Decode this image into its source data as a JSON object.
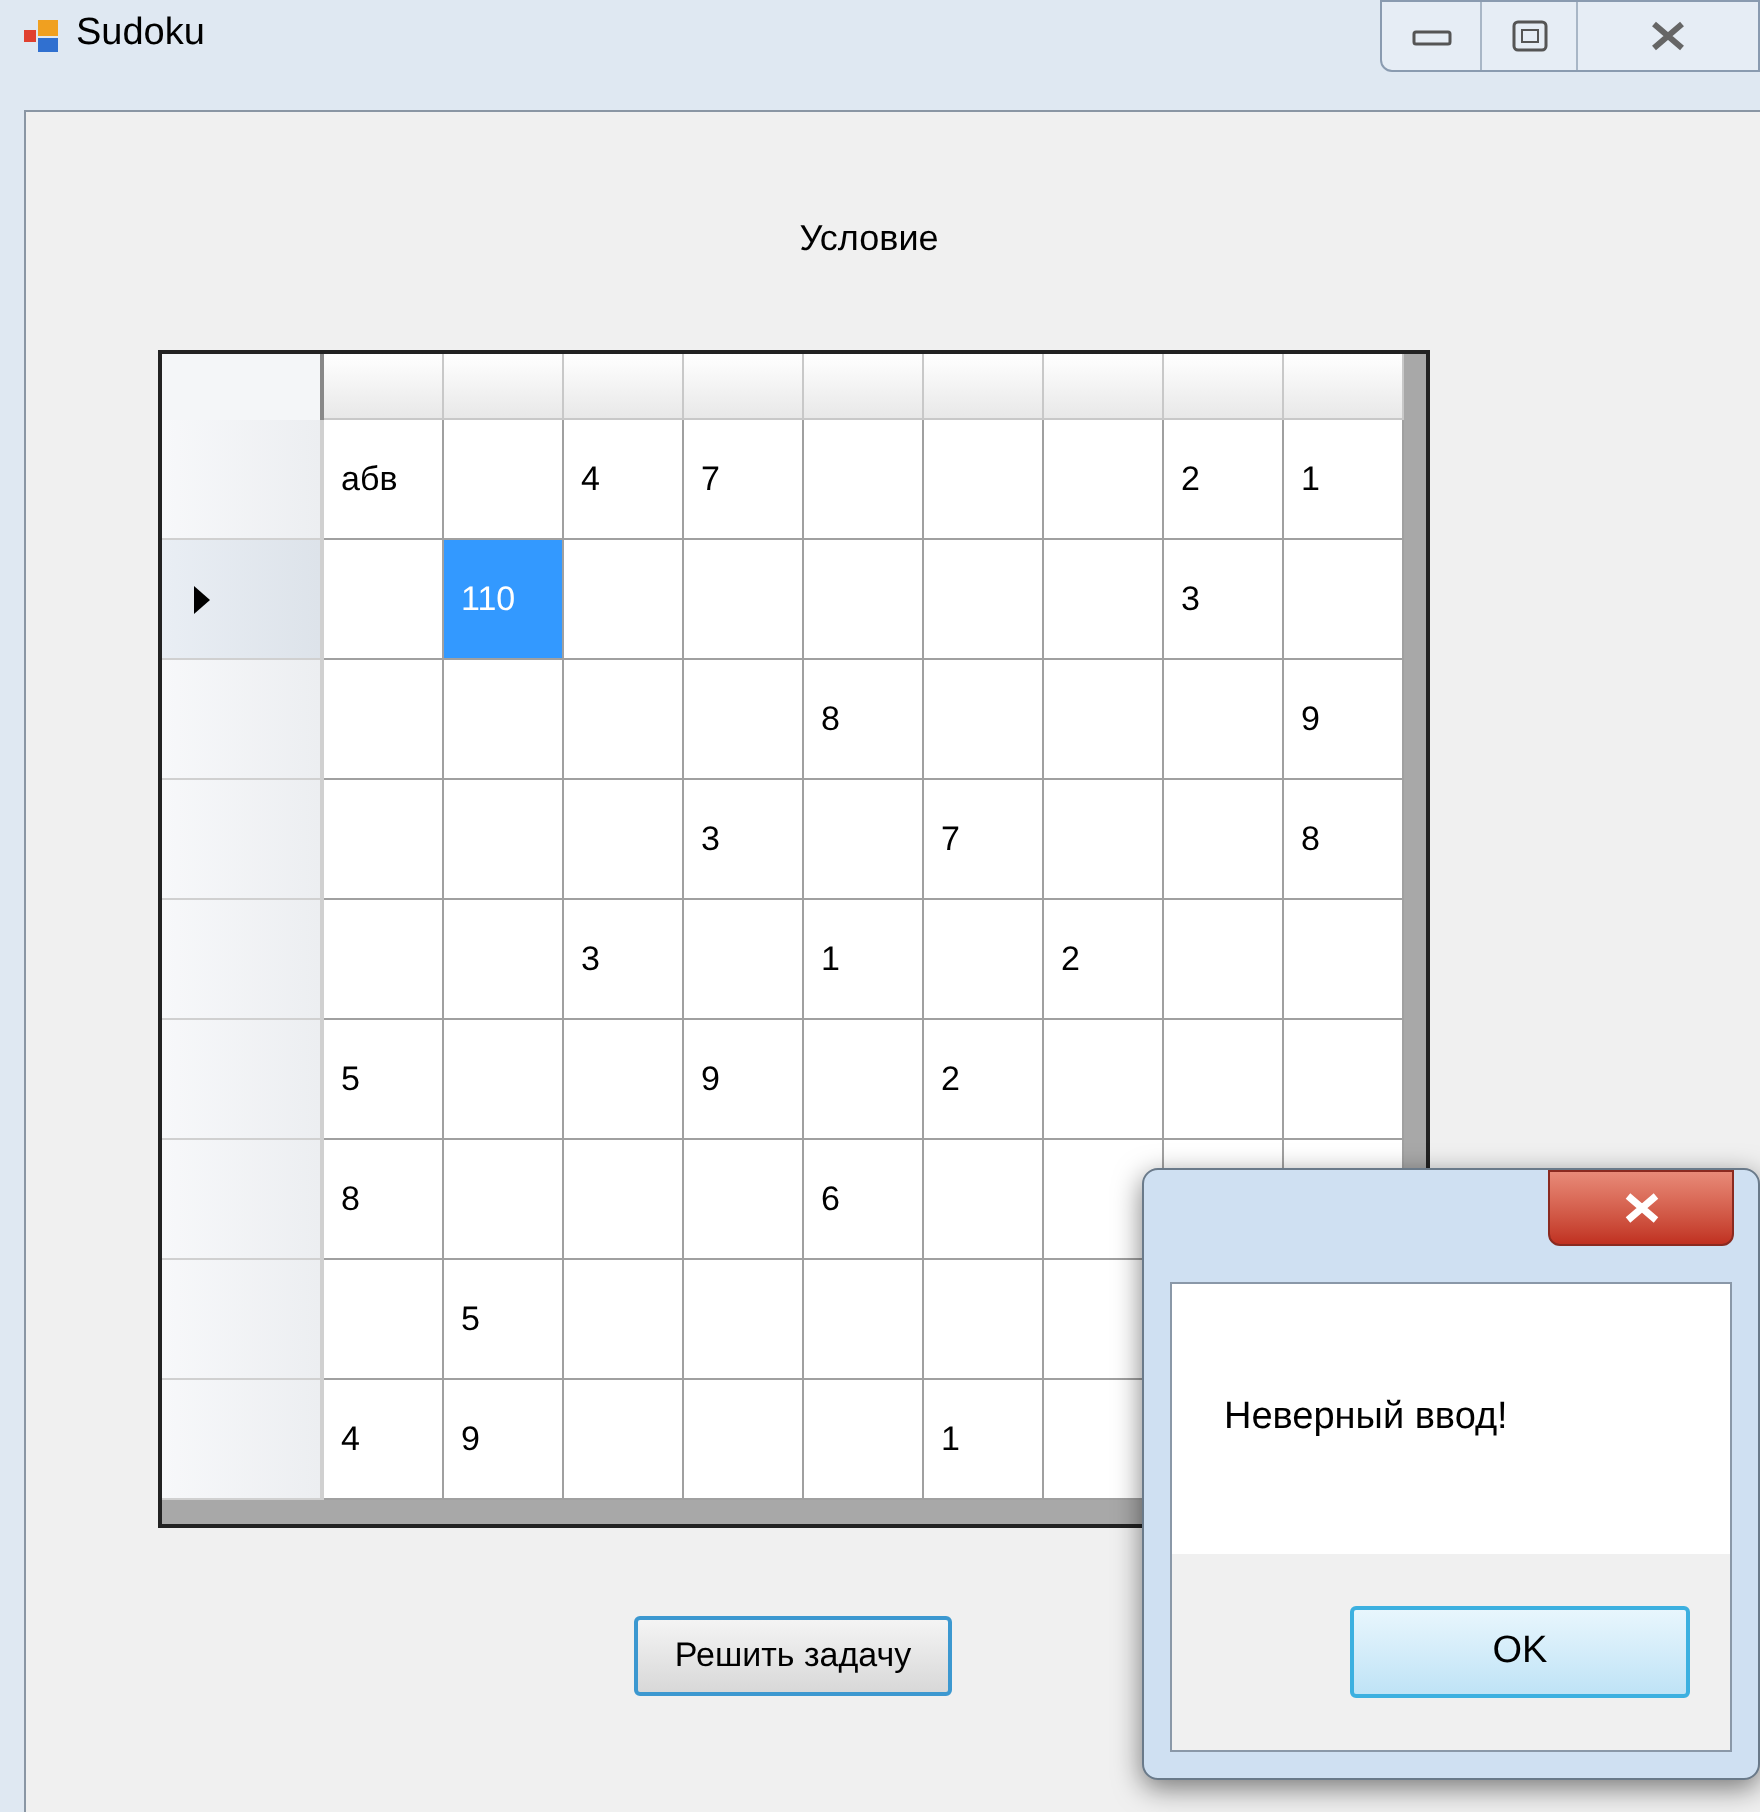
{
  "window": {
    "title": "Sudoku"
  },
  "label": "Условие",
  "grid": {
    "rows": [
      {
        "current": false,
        "cells": [
          {
            "value": "абв",
            "selected": false
          },
          {
            "selected": false
          },
          {
            "value": "4",
            "selected": false
          },
          {
            "value": "7",
            "selected": false
          },
          {
            "selected": false
          },
          {
            "selected": false
          },
          {
            "selected": false
          },
          {
            "value": "2",
            "selected": false
          },
          {
            "value": "1",
            "selected": false
          }
        ]
      },
      {
        "current": true,
        "cells": [
          {
            "selected": false
          },
          {
            "value": "110",
            "selected": true
          },
          {
            "selected": false
          },
          {
            "selected": false
          },
          {
            "selected": false
          },
          {
            "selected": false
          },
          {
            "selected": false
          },
          {
            "value": "3",
            "selected": false
          },
          {
            "selected": false
          }
        ]
      },
      {
        "current": false,
        "cells": [
          {
            "selected": false
          },
          {
            "selected": false
          },
          {
            "selected": false
          },
          {
            "selected": false
          },
          {
            "value": "8",
            "selected": false
          },
          {
            "selected": false
          },
          {
            "selected": false
          },
          {
            "selected": false
          },
          {
            "value": "9",
            "selected": false
          }
        ]
      },
      {
        "current": false,
        "cells": [
          {
            "selected": false
          },
          {
            "selected": false
          },
          {
            "selected": false
          },
          {
            "value": "3",
            "selected": false
          },
          {
            "selected": false
          },
          {
            "value": "7",
            "selected": false
          },
          {
            "selected": false
          },
          {
            "selected": false
          },
          {
            "value": "8",
            "selected": false
          }
        ]
      },
      {
        "current": false,
        "cells": [
          {
            "selected": false
          },
          {
            "selected": false
          },
          {
            "value": "3",
            "selected": false
          },
          {
            "selected": false
          },
          {
            "value": "1",
            "selected": false
          },
          {
            "selected": false
          },
          {
            "value": "2",
            "selected": false
          },
          {
            "selected": false
          },
          {
            "selected": false
          }
        ]
      },
      {
        "current": false,
        "cells": [
          {
            "value": "5",
            "selected": false
          },
          {
            "selected": false
          },
          {
            "selected": false
          },
          {
            "value": "9",
            "selected": false
          },
          {
            "selected": false
          },
          {
            "value": "2",
            "selected": false
          },
          {
            "selected": false
          },
          {
            "selected": false
          },
          {
            "selected": false
          }
        ]
      },
      {
        "current": false,
        "cells": [
          {
            "value": "8",
            "selected": false
          },
          {
            "selected": false
          },
          {
            "selected": false
          },
          {
            "selected": false
          },
          {
            "value": "6",
            "selected": false
          },
          {
            "selected": false
          },
          {
            "selected": false
          }
        ]
      },
      {
        "current": false,
        "cells": [
          {
            "selected": false
          },
          {
            "value": "5",
            "selected": false
          },
          {
            "selected": false
          },
          {
            "selected": false
          },
          {
            "selected": false
          },
          {
            "selected": false
          },
          {
            "selected": false
          }
        ]
      },
      {
        "current": false,
        "cells": [
          {
            "value": "4",
            "selected": false
          },
          {
            "value": "9",
            "selected": false
          },
          {
            "selected": false
          },
          {
            "selected": false
          },
          {
            "selected": false
          },
          {
            "value": "1",
            "selected": false
          },
          {
            "selected": false
          }
        ]
      }
    ]
  },
  "solve_button": "Решить задачу",
  "dialog": {
    "message": "Неверный ввод!",
    "button": "OK"
  }
}
